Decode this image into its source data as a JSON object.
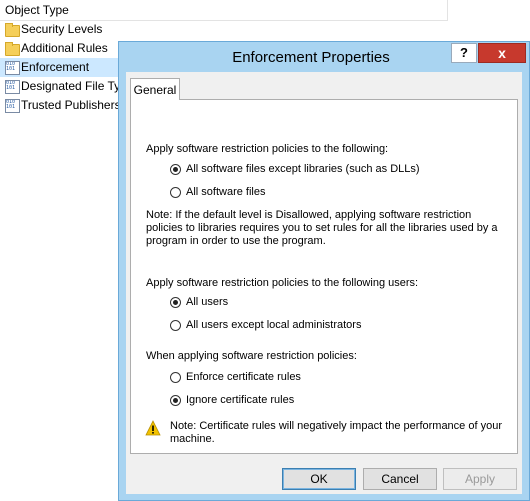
{
  "background": {
    "column_header": "Object Type",
    "items": [
      {
        "label": "Security Levels",
        "icon": "folder-icon",
        "selected": false
      },
      {
        "label": "Additional Rules",
        "icon": "folder-icon",
        "selected": false
      },
      {
        "label": "Enforcement",
        "icon": "policy-icon",
        "selected": true
      },
      {
        "label": "Designated File Ty",
        "icon": "policy-icon",
        "selected": false
      },
      {
        "label": "Trusted Publishers",
        "icon": "policy-icon",
        "selected": false
      }
    ]
  },
  "dialog": {
    "title": "Enforcement Properties",
    "help_label": "?",
    "close_label": "x",
    "tab_label": "General",
    "apply_to_heading": "Apply software restriction policies to the following:",
    "apply_to_options": [
      {
        "label": "All software files except libraries (such as DLLs)",
        "checked": true
      },
      {
        "label": "All software files",
        "checked": false
      }
    ],
    "libraries_note": "Note:  If the default level is Disallowed, applying software restriction policies to libraries requires you to set rules for all the libraries used by a program in order to use the program.",
    "users_heading": "Apply software restriction policies to the following users:",
    "users_options": [
      {
        "label": "All users",
        "checked": true
      },
      {
        "label": "All users except local administrators",
        "checked": false
      }
    ],
    "cert_heading": "When applying software restriction policies:",
    "cert_options": [
      {
        "label": "Enforce certificate rules",
        "checked": false
      },
      {
        "label": "Ignore certificate rules",
        "checked": true
      }
    ],
    "cert_note": "Note:  Certificate rules will negatively impact the performance of your machine.",
    "buttons": {
      "ok": "OK",
      "cancel": "Cancel",
      "apply": "Apply"
    }
  },
  "colors": {
    "dialog_frame": "#a9d4f1",
    "close_button": "#c7392d",
    "selection": "#cce8ff",
    "warning": "#f2c200"
  }
}
